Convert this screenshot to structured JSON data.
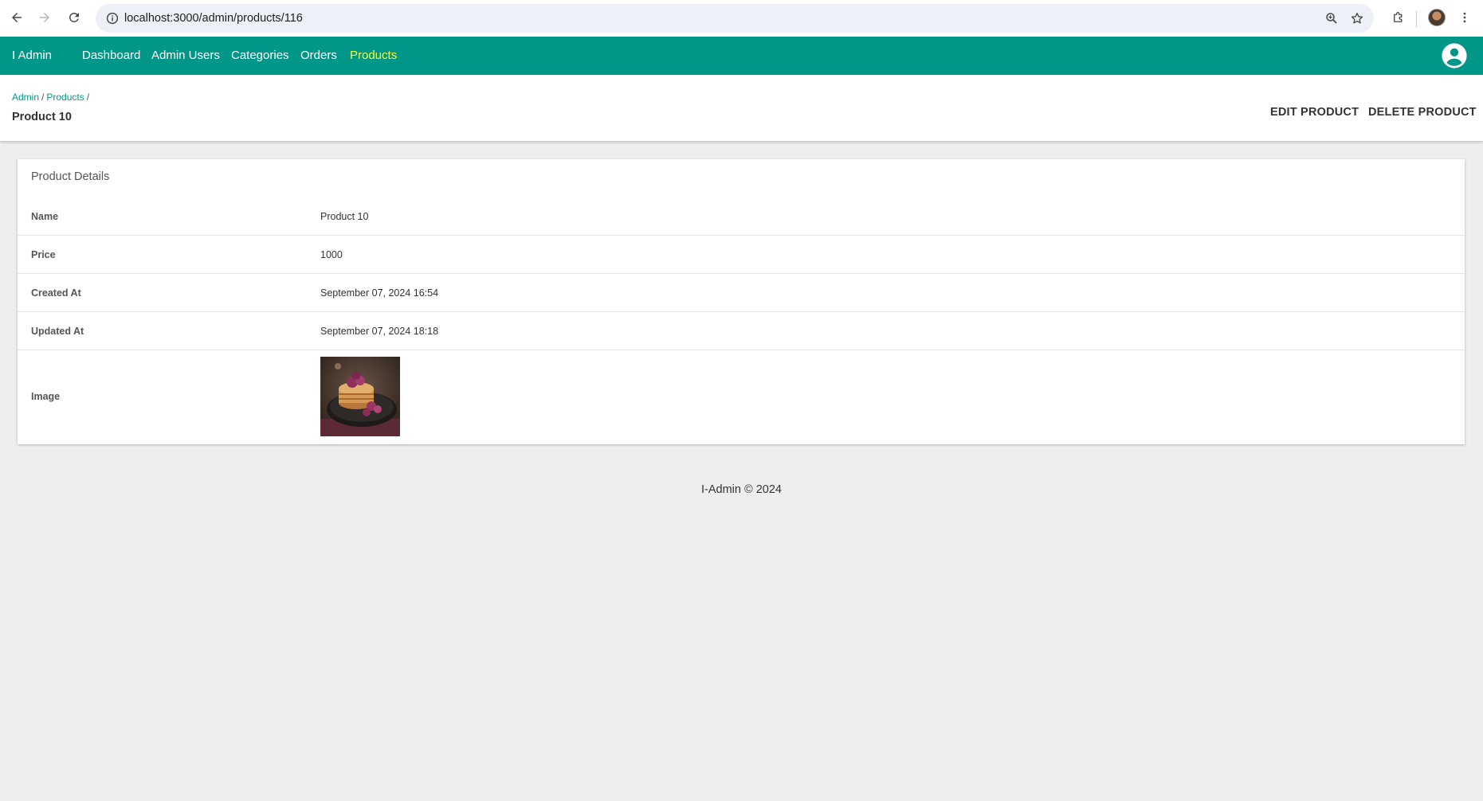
{
  "browser": {
    "url": "localhost:3000/admin/products/116"
  },
  "appbar": {
    "brand": "I Admin",
    "nav": [
      {
        "label": "Dashboard"
      },
      {
        "label": "Admin Users"
      },
      {
        "label": "Categories"
      },
      {
        "label": "Orders"
      },
      {
        "label": "Products"
      }
    ],
    "active_color": "#eeff41",
    "bar_color": "#009688"
  },
  "header": {
    "breadcrumb": {
      "admin": "Admin",
      "products": "Products",
      "sep": "/"
    },
    "title": "Product 10",
    "edit_label": "EDIT PRODUCT",
    "delete_label": "DELETE PRODUCT"
  },
  "details": {
    "title": "Product Details",
    "rows": [
      {
        "label": "Name",
        "value": "Product 10"
      },
      {
        "label": "Price",
        "value": "1000"
      },
      {
        "label": "Created At",
        "value": "September 07, 2024 16:54"
      },
      {
        "label": "Updated At",
        "value": "September 07, 2024 18:18"
      },
      {
        "label": "Image"
      }
    ]
  },
  "footer": {
    "text": "I-Admin © 2024"
  }
}
